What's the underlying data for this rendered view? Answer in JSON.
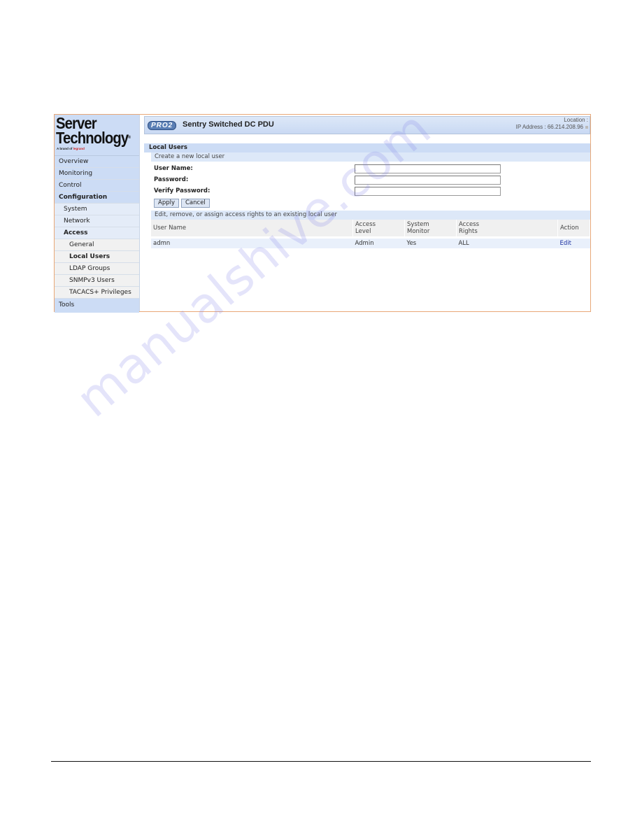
{
  "logo": {
    "line1": "Server",
    "line2": "Technology",
    "registered": "®",
    "brand_prefix": "A brand of ",
    "brand_name": "legrand"
  },
  "header": {
    "badge": "PRO2",
    "product_title": "Sentry Switched DC PDU",
    "location_label": "Location :",
    "ip_label": "IP Address : 66.214.208.96"
  },
  "sidebar": {
    "items": [
      {
        "label": "Overview"
      },
      {
        "label": "Monitoring"
      },
      {
        "label": "Control"
      },
      {
        "label": "Configuration"
      },
      {
        "label": "System"
      },
      {
        "label": "Network"
      },
      {
        "label": "Access"
      },
      {
        "label": "General"
      },
      {
        "label": "Local Users"
      },
      {
        "label": "LDAP Groups"
      },
      {
        "label": "SNMPv3 Users"
      },
      {
        "label": "TACACS+ Privileges"
      },
      {
        "label": "Tools"
      }
    ]
  },
  "main": {
    "section_title": "Local Users",
    "create_bar": "Create a new local user",
    "form": {
      "username_label": "User Name:",
      "username_value": "",
      "password_label": "Password:",
      "password_value": "",
      "verify_label": "Verify Password:",
      "verify_value": "",
      "apply_label": "Apply",
      "cancel_label": "Cancel"
    },
    "edit_bar": "Edit, remove, or assign access rights to an existing local user",
    "table": {
      "headers": {
        "user_name": "User Name",
        "access_level_1": "Access",
        "access_level_2": "Level",
        "system_monitor_1": "System",
        "system_monitor_2": "Monitor",
        "access_rights_1": "Access",
        "access_rights_2": "Rights",
        "action": "Action"
      },
      "rows": [
        {
          "user_name": "admn",
          "access_level": "Admin",
          "system_monitor": "Yes",
          "access_rights": "ALL",
          "action": "Edit"
        }
      ]
    }
  },
  "watermark": "manualshive.com"
}
